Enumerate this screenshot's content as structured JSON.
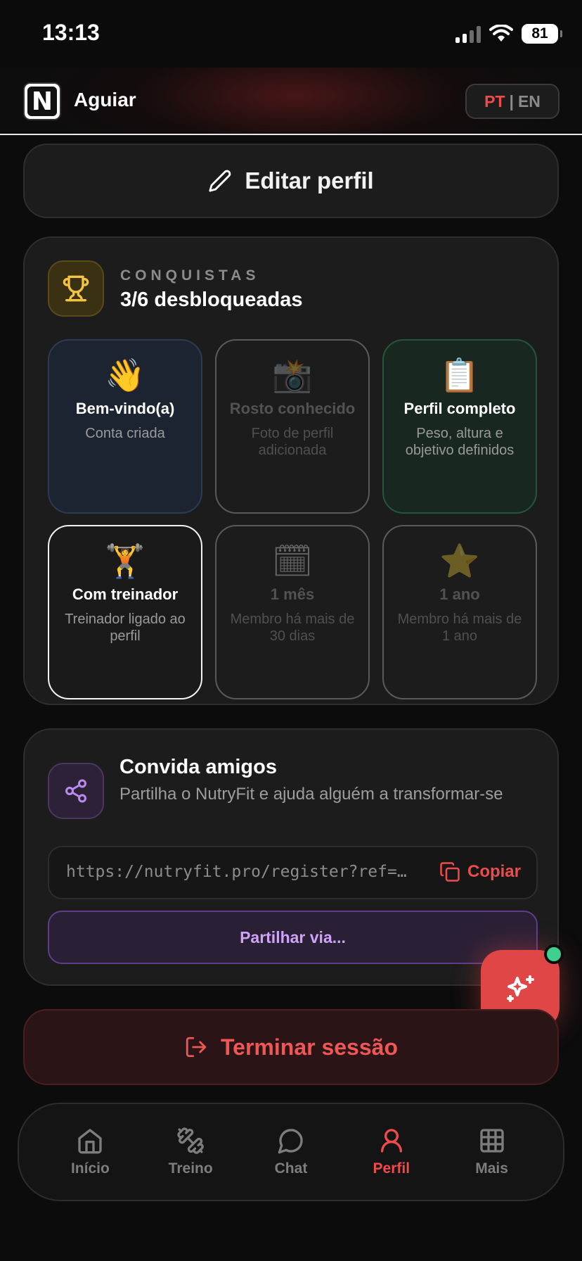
{
  "status_bar": {
    "time": "13:13",
    "battery": "81"
  },
  "header": {
    "app_name": "Aguiar",
    "logo_letter": "N",
    "lang_pt": "PT",
    "lang_separator": "|",
    "lang_en": "EN"
  },
  "edit_profile": {
    "label": "Editar perfil"
  },
  "achievements": {
    "kicker": "CONQUISTAS",
    "count": "3/6 desbloqueadas",
    "items": [
      {
        "emoji": "👋",
        "title": "Bem-vindo(a)",
        "desc": "Conta criada",
        "state": "unlocked"
      },
      {
        "emoji": "📸",
        "title": "Rosto conhecido",
        "desc": "Foto de perfil adicionada",
        "state": "locked"
      },
      {
        "emoji": "📋",
        "title": "Perfil completo",
        "desc": "Peso, altura e objetivo definidos",
        "state": "unlocked"
      },
      {
        "emoji": "🏋",
        "title": "Com treinador",
        "desc": "Treinador ligado ao perfil",
        "state": "unlocked"
      },
      {
        "emoji": "🗓",
        "title": "1 mês",
        "desc": "Membro há mais de 30 dias",
        "state": "locked"
      },
      {
        "emoji": "⭐",
        "title": "1 ano",
        "desc": "Membro há mais de 1 ano",
        "state": "locked"
      }
    ]
  },
  "invite": {
    "title": "Convida amigos",
    "subtitle": "Partilha o NutryFit e ajuda alguém a transformar-se",
    "link": "https://nutryfit.pro/register?ref=aguiar",
    "copy_label": "Copiar",
    "share_label": "Partilhar via..."
  },
  "logout": {
    "label": "Terminar sessão"
  },
  "nav": {
    "items": [
      {
        "label": "Início",
        "icon": "home-icon"
      },
      {
        "label": "Treino",
        "icon": "dumbbell-icon"
      },
      {
        "label": "Chat",
        "icon": "chat-icon"
      },
      {
        "label": "Perfil",
        "icon": "user-icon",
        "active": true
      },
      {
        "label": "Mais",
        "icon": "grid-icon"
      }
    ]
  },
  "colors": {
    "accent": "#ef4b4b",
    "purple": "#cfa3f7",
    "online": "#3fcf8e"
  }
}
